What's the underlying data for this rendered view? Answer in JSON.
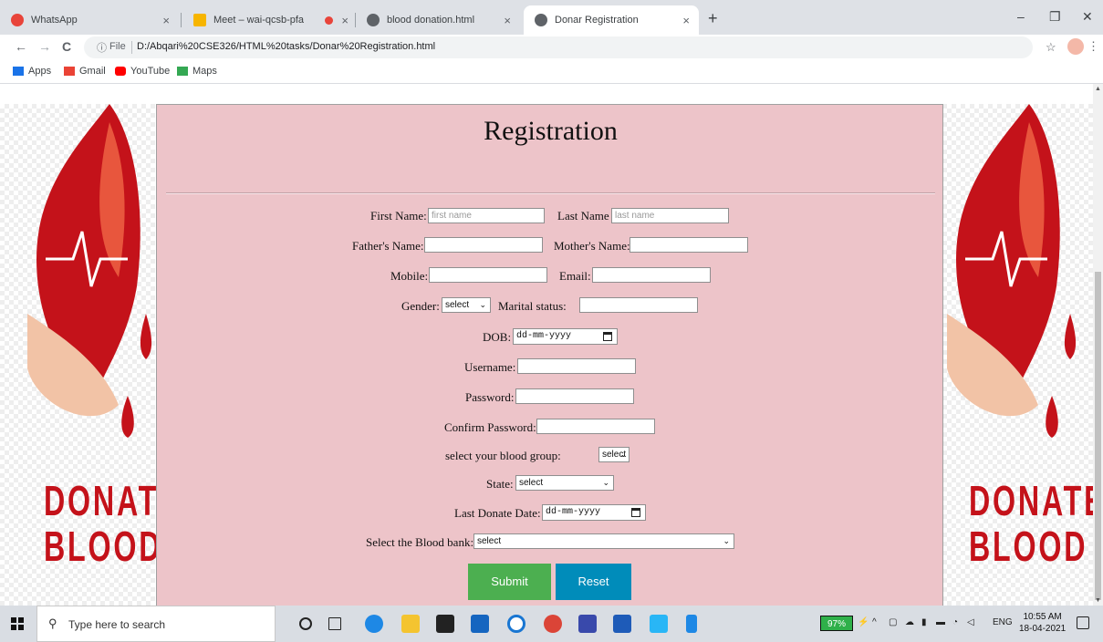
{
  "browser": {
    "tabs": [
      {
        "title": "WhatsApp",
        "close": "×",
        "color": "#e8443a"
      },
      {
        "title": "Meet – wai-qcsb-pfa",
        "close": "×",
        "color": "#f7b500"
      },
      {
        "title": "",
        "close": "×",
        "color": "#e8443a"
      },
      {
        "title": "blood donation.html",
        "close": "×",
        "color": "#5f6368"
      },
      {
        "title": "Donar Registration",
        "close": "×",
        "color": "#5f6368"
      }
    ],
    "new_tab": "+",
    "window_minimize": "–",
    "window_maximize": "❐",
    "window_close": "✕",
    "nav_back": "←",
    "nav_forward": "→",
    "nav_reload": "C",
    "omnibox_info": "ⓘ",
    "omnibox_scheme": "File",
    "url": "D:/Abqari%20CSE326/HTML%20tasks/Donar%20Registration.html",
    "star": "☆",
    "extensions": "✱",
    "menu": "⋮",
    "bookmarks": [
      {
        "label": "Apps",
        "color": "#1a73e8"
      },
      {
        "label": "Gmail",
        "color": "#ea4335"
      },
      {
        "label": "YouTube",
        "color": "#ff0000"
      },
      {
        "label": "Maps",
        "color": "#34a853"
      }
    ]
  },
  "page": {
    "title": "Registration",
    "side_text": [
      "DONATE",
      "BLOOD"
    ],
    "accent": "#c4121a",
    "form_bg": "#edc4c9",
    "fields": {
      "first_name_label": "First Name:",
      "first_name_placeholder": "first name",
      "last_name_label": "Last Name",
      "last_name_placeholder": "last name",
      "father_label": "Father's Name:",
      "mother_label": "Mother's Name:",
      "mobile_label": "Mobile:",
      "email_label": "Email:",
      "gender_label": "Gender:",
      "gender_value": "select",
      "marital_label": "Marital status:",
      "dob_label": "DOB:",
      "dob_value": "dd-mm-yyyy",
      "username_label": "Username:",
      "password_label": "Password:",
      "confirm_label": "Confirm Password:",
      "blood_group_label": "select your blood group:",
      "blood_group_value": "select",
      "state_label": "State:",
      "state_value": "select",
      "last_donate_label": "Last Donate Date:",
      "last_donate_value": "dd-mm-yyyy",
      "blood_bank_label": "Select the Blood bank:",
      "blood_bank_value": "select"
    },
    "submit_label": "Submit",
    "reset_label": "Reset",
    "submit_color": "#4caf50",
    "reset_color": "#008cba"
  },
  "taskbar": {
    "search_placeholder": "Type here to search",
    "battery": "97%",
    "language": "ENG",
    "time": "10:55 AM",
    "date": "18-04-2021"
  }
}
